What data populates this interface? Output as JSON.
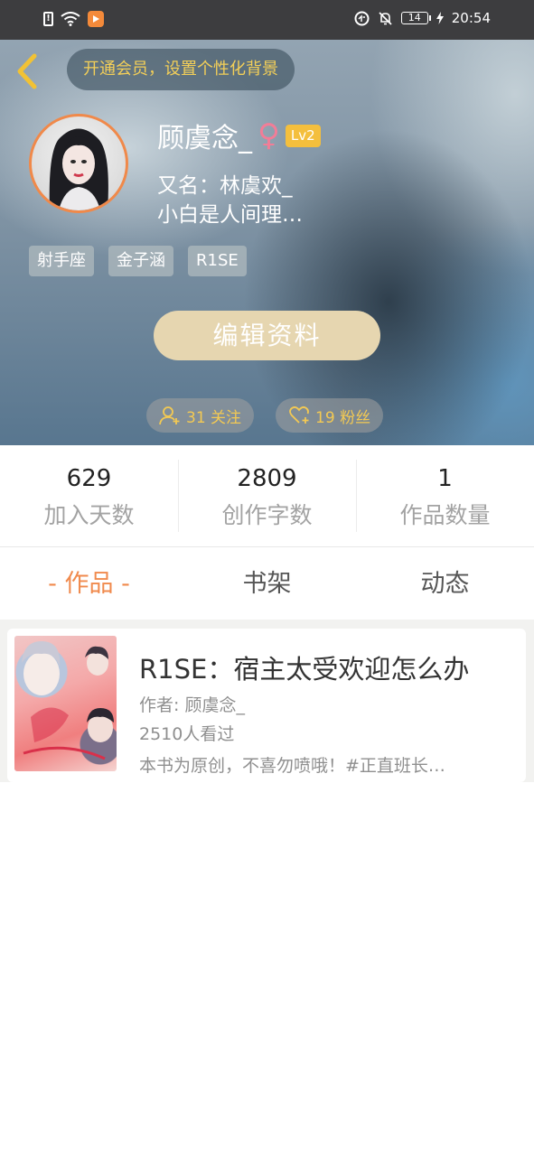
{
  "status_bar": {
    "time": "20:54",
    "battery": "14",
    "icons_left": [
      "sim-alert-icon",
      "wifi-icon",
      "app-notification-icon"
    ],
    "icons_right": [
      "data-saver-icon",
      "bell-off-icon",
      "battery-icon",
      "charging-icon"
    ]
  },
  "header": {
    "vip_banner": "开通会员，设置个性化背景",
    "username": "顾虞念_",
    "gender_symbol": "♀",
    "level": "Lv2",
    "alias": "又名：林虞欢_",
    "signature": "小白是人间理…",
    "tags": [
      "射手座",
      "金子涵",
      "R1SE"
    ],
    "edit_button": "编辑资料",
    "follow_count": "31 关注",
    "fans_count": "19 粉丝",
    "colors": {
      "accent_gold": "#f3cf58",
      "edit_button_bg": "#e6d6b0",
      "avatar_ring": "#f0894a",
      "level_badge": "#f4bf3d"
    }
  },
  "stats": [
    {
      "value": "629",
      "label": "加入天数"
    },
    {
      "value": "2809",
      "label": "创作字数"
    },
    {
      "value": "1",
      "label": "作品数量"
    }
  ],
  "tabs": [
    {
      "label": "- 作品 -",
      "active": true
    },
    {
      "label": "书架",
      "active": false
    },
    {
      "label": "动态",
      "active": false
    }
  ],
  "books": [
    {
      "title": "R1SE：宿主太受欢迎怎么办",
      "author": "作者: 顾虞念_",
      "views": "2510人看过",
      "description": "本书为原创，不喜勿喷哦！#正直班长…"
    }
  ],
  "theme": {
    "active_tab_color": "#f08a4d"
  }
}
